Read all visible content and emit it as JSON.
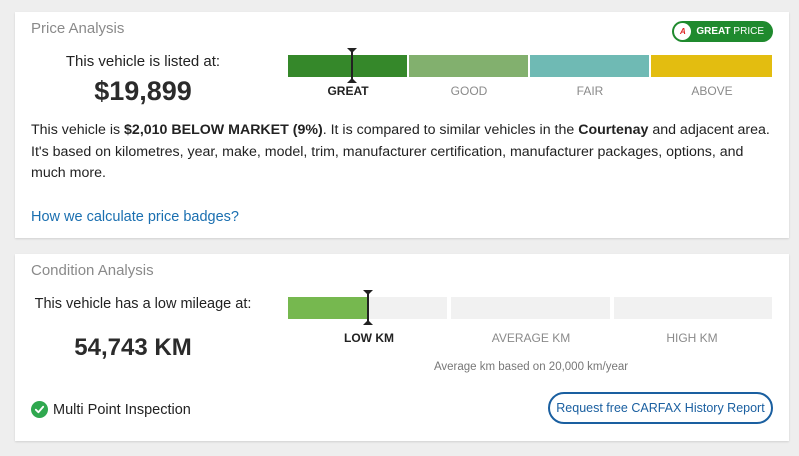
{
  "price_analysis": {
    "title": "Price Analysis",
    "badge": {
      "strong": "GREAT",
      "thin": " PRICE",
      "logo": "A"
    },
    "listed_label": "This vehicle is listed at:",
    "price": "$19,899",
    "segments": [
      {
        "label": "GREAT",
        "color": "#35882a",
        "active": true
      },
      {
        "label": "GOOD",
        "color": "#82b06e",
        "active": false
      },
      {
        "label": "FAIR",
        "color": "#6fbab4",
        "active": false
      },
      {
        "label": "ABOVE",
        "color": "#e3bd10",
        "active": false
      }
    ],
    "description": {
      "pre": "This vehicle is ",
      "amount": "$2,010 BELOW MARKET (9%)",
      "mid": ". It is compared to similar vehicles in the ",
      "location": "Courtenay",
      "post": " and adjacent area. It's based on kilometres, year, make, model, trim, manufacturer certification, manufacturer packages, options, and much more."
    },
    "link": "How we calculate price badges?"
  },
  "condition_analysis": {
    "title": "Condition Analysis",
    "mileage_label": "This vehicle has a low mileage at:",
    "mileage": "54,743 KM",
    "segments": [
      {
        "label": "LOW KM",
        "active": true,
        "fill_fraction": 0.5
      },
      {
        "label": "AVERAGE KM",
        "active": false,
        "fill_fraction": 0
      },
      {
        "label": "HIGH KM",
        "active": false,
        "fill_fraction": 0
      }
    ],
    "fill_color": "#76b84f",
    "average_note": "Average km based on 20,000 km/year",
    "inspection": "Multi Point Inspection",
    "report_button": "Request free CARFAX History Report"
  }
}
